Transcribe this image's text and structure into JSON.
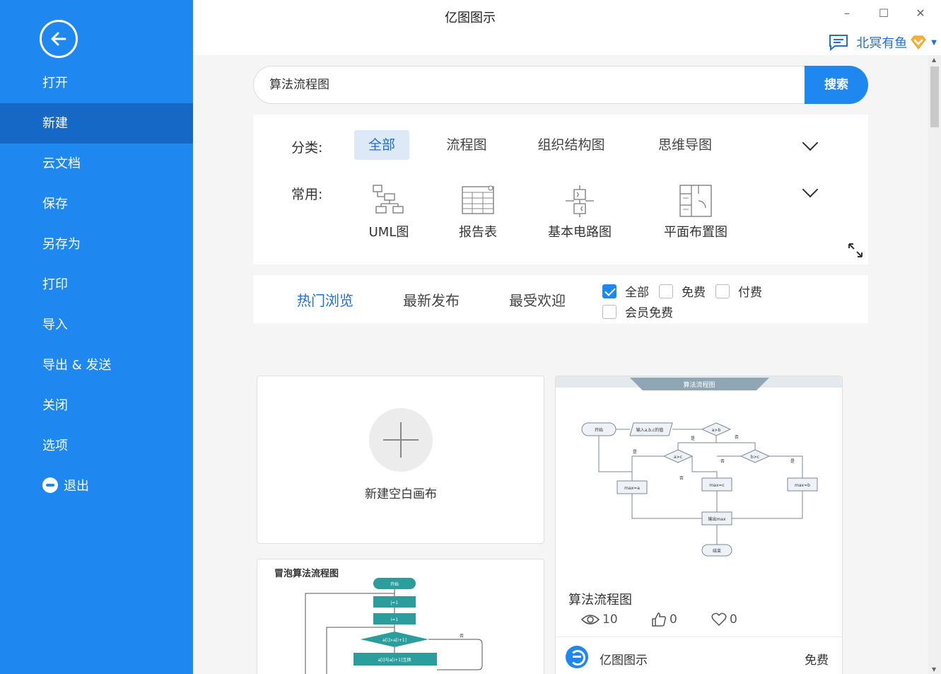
{
  "app": {
    "title": "亿图图示",
    "window": {
      "minimize": "–",
      "maximize": "☐",
      "close": "✕"
    },
    "user_name": "北冥有鱼"
  },
  "sidebar": {
    "items": [
      {
        "label": "打开"
      },
      {
        "label": "新建",
        "active": true
      },
      {
        "label": "云文档"
      },
      {
        "label": "保存"
      },
      {
        "label": "另存为"
      },
      {
        "label": "打印"
      },
      {
        "label": "导入"
      },
      {
        "label": "导出 & 发送"
      },
      {
        "label": "关闭"
      },
      {
        "label": "选项"
      },
      {
        "label": "退出"
      }
    ]
  },
  "search": {
    "value": "算法流程图",
    "button": "搜索"
  },
  "categories": {
    "label": "分类:",
    "tabs": [
      "全部",
      "流程图",
      "组织结构图",
      "思维导图"
    ],
    "common_label": "常用:",
    "common": [
      "UML图",
      "报告表",
      "基本电路图",
      "平面布置图"
    ]
  },
  "filters": {
    "sort_tabs": [
      "热门浏览",
      "最新发布",
      "最受欢迎"
    ],
    "checks": [
      {
        "label": "全部",
        "checked": true
      },
      {
        "label": "免费",
        "checked": false
      },
      {
        "label": "付费",
        "checked": false
      },
      {
        "label": "会员免费",
        "checked": false
      }
    ]
  },
  "cards": {
    "blank": {
      "label": "新建空白画布"
    },
    "template": {
      "banner": "算法流程图",
      "title": "算法流程图",
      "views": "10",
      "likes": "0",
      "favorites": "0",
      "author": "亿图图示",
      "price": "免费",
      "nodes": [
        "开始",
        "输入a,b,c的值",
        "a>b",
        "a>c",
        "b>c",
        "max=a",
        "max=c",
        "max=b",
        "输出max",
        "结束",
        "是",
        "否"
      ]
    },
    "bubble": {
      "title": "冒泡算法流程图",
      "nodes": [
        "开始",
        "j=1",
        "i=1",
        "a[i]>a[i+1]",
        "a[i]与a[i+1]互换",
        "否"
      ]
    }
  },
  "colors": {
    "primary": "#1e88f0",
    "sidebar_active": "#1668c7",
    "teal": "#2a9d9c"
  }
}
